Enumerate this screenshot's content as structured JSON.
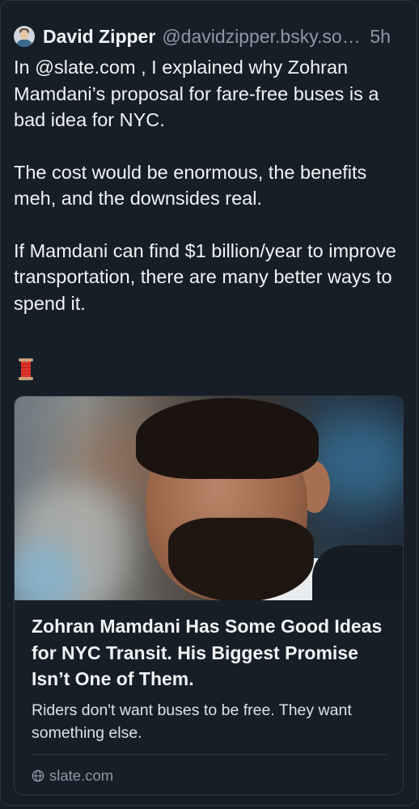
{
  "post": {
    "author": {
      "display_name": "David Zipper",
      "handle": "@davidzipper.bsky.social",
      "avatar_icon": "profile-photo"
    },
    "timestamp": "5h",
    "paragraphs": [
      "In @slate.com , I explained why Zohran Mamdani’s proposal for fare-free buses is a bad idea for NYC.",
      "The cost would be enormous, the benefits meh, and the downsides real.",
      "If Mamdani can find $1 billion/year to improve transportation, there are many better ways to spend it."
    ],
    "emoji": "spool-of-thread"
  },
  "link_card": {
    "image_alt": "photo of Zohran Mamdani",
    "title": "Zohran Mamdani Has Some Good Ideas for NYC Transit. His Biggest Promise Isn’t One of Them.",
    "description": "Riders don't want buses to be free. They want something else.",
    "domain": "slate.com",
    "domain_icon": "globe-icon"
  },
  "colors": {
    "background": "#161e27",
    "text": "#f1f3f5",
    "muted": "#8d99a6",
    "border": "#2e3945"
  }
}
